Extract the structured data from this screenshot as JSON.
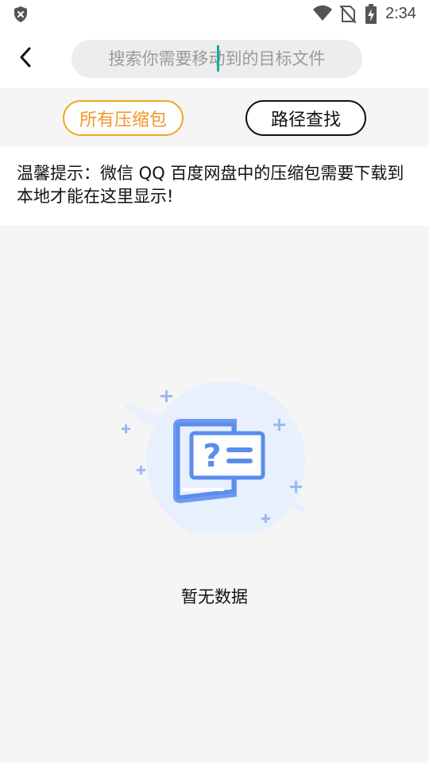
{
  "status_bar": {
    "time": "2:34",
    "icons": [
      "shield-icon",
      "wifi-icon",
      "no-sim-icon",
      "battery-charging-icon"
    ]
  },
  "header": {
    "back_icon": "chevron-left-icon",
    "search_placeholder": "搜索你需要移动到的目标文件",
    "search_value": ""
  },
  "tabs": [
    {
      "label": "所有压缩包",
      "selected": true
    },
    {
      "label": "路径查找",
      "selected": false
    }
  ],
  "tip": {
    "text": "温馨提示：微信 QQ 百度网盘中的压缩包需要下载到本地才能在这里显示!"
  },
  "empty_state": {
    "icon": "unknown-file-icon",
    "text": "暂无数据"
  },
  "colors": {
    "accent": "#f5a623",
    "caret": "#19a7a0",
    "illustration_blue": "#5b8def",
    "illustration_bg": "#e8effd"
  }
}
